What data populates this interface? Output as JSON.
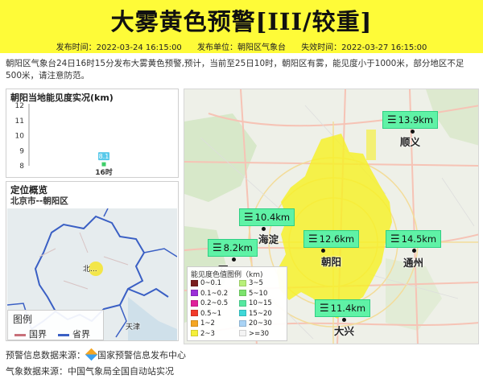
{
  "header": {
    "title": "大雾黄色预警[III/较重]",
    "issue_time": "发布时间：2022-03-24 16:15:00",
    "issuer": "发布单位：朝阳区气象台",
    "expire_time": "失效时间：2022-03-27 16:15:00"
  },
  "description": "朝阳区气象台24日16时15分发布大雾黄色预警,预计，当前至25日10时，朝阳区有雾，能见度小于1000米，部分地区不足500米，请注意防范。",
  "visibility_panel": {
    "title": "朝阳当地能见度实况(km)"
  },
  "chart_data": {
    "type": "scatter",
    "title": "朝阳当地能见度实况(km)",
    "categories": [
      "16时"
    ],
    "values": [
      8.1
    ],
    "data_labels": [
      "8.1"
    ],
    "yticks": [
      8,
      9,
      10,
      11,
      12
    ],
    "ylim": [
      8,
      12
    ],
    "xlabel": "",
    "ylabel": ""
  },
  "location_panel": {
    "title": "定位概览",
    "region": "北京市--朝阳区",
    "legend_title": "图例",
    "legend_items": [
      {
        "label": "国界",
        "color": "#c8707a"
      },
      {
        "label": "省界",
        "color": "#3a5fc4"
      }
    ],
    "map_labels": {
      "beijing": "北...",
      "tianjin": "天津"
    }
  },
  "main_map": {
    "stations": [
      {
        "id": "shunyi",
        "value": "13.9km",
        "place": "顺义"
      },
      {
        "id": "haidian",
        "value": "10.4km",
        "place": "海淀"
      },
      {
        "id": "shijingshan",
        "value": "8.2km",
        "place": "石..."
      },
      {
        "id": "chaoyang",
        "value": "12.6km",
        "place": "朝阳"
      },
      {
        "id": "tongzhou",
        "value": "14.5km",
        "place": "通州"
      },
      {
        "id": "daxing",
        "value": "11.4km",
        "place": "大兴"
      }
    ],
    "station_icon": "fog-lines-icon",
    "fog_color": "#f7f026",
    "station_color": "#5ff2a6"
  },
  "color_legend": {
    "title": "能见度色值图例（km)",
    "items": [
      {
        "label": "0~0.1",
        "color": "#7a1e1e"
      },
      {
        "label": "3~5",
        "color": "#b8f07a"
      },
      {
        "label": "0.1~0.2",
        "color": "#9b2fd8"
      },
      {
        "label": "5~10",
        "color": "#7ce36d"
      },
      {
        "label": "0.2~0.5",
        "color": "#e0209a"
      },
      {
        "label": "10~15",
        "color": "#56e8a0"
      },
      {
        "label": "0.5~1",
        "color": "#f23a2a"
      },
      {
        "label": "15~20",
        "color": "#3ed8d8"
      },
      {
        "label": "1~2",
        "color": "#f5a623"
      },
      {
        "label": "20~30",
        "color": "#a9d3f5"
      },
      {
        "label": "2~3",
        "color": "#f5f03a"
      },
      {
        "label": ">=30",
        "color": "#f4f4f4"
      }
    ]
  },
  "footer": {
    "source1_label": "预警信息数据来源：",
    "source1_name": "国家预警信息发布中心",
    "source2": "气象数据来源：中国气象局全国自动站实况"
  }
}
